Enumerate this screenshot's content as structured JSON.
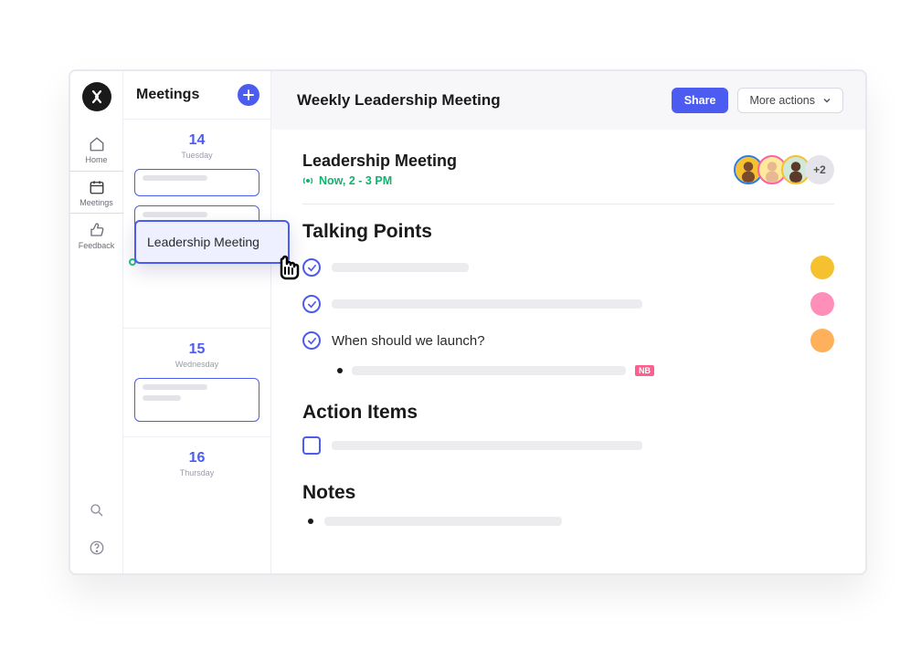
{
  "rail": {
    "items": [
      {
        "label": "Home"
      },
      {
        "label": "Meetings"
      },
      {
        "label": "Feedback"
      }
    ]
  },
  "sidebar": {
    "title": "Meetings",
    "days": [
      {
        "num": "14",
        "name": "Tuesday"
      },
      {
        "num": "15",
        "name": "Wednesday"
      },
      {
        "num": "16",
        "name": "Thursday"
      }
    ],
    "popover_event": "Leadership Meeting"
  },
  "topbar": {
    "title": "Weekly Leadership Meeting",
    "share": "Share",
    "more": "More actions"
  },
  "meeting": {
    "title": "Leadership Meeting",
    "now": "Now, 2 - 3 PM",
    "attendee_more": "+2"
  },
  "sections": {
    "talking_points": "Talking Points",
    "action_items": "Action Items",
    "notes": "Notes"
  },
  "talking_points": {
    "items": [
      {
        "text": ""
      },
      {
        "text": ""
      },
      {
        "text": "When should we launch?"
      }
    ],
    "sub_badge": "NB"
  },
  "colors": {
    "primary": "#4c5bf0",
    "success": "#12b26f"
  }
}
